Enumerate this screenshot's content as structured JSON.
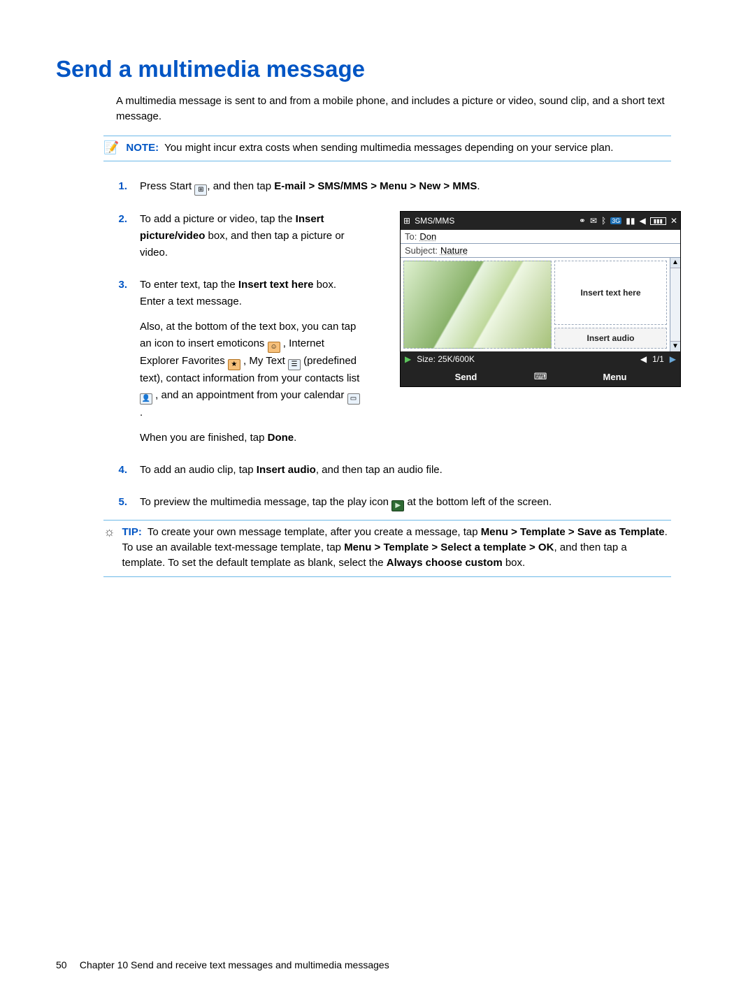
{
  "title": "Send a multimedia message",
  "intro": "A multimedia message is sent to and from a mobile phone, and includes a picture or video, sound clip, and a short text message.",
  "note": {
    "label": "NOTE:",
    "text": "You might incur extra costs when sending multimedia messages depending on your service plan."
  },
  "steps": {
    "s1": {
      "num": "1.",
      "prefix": "Press Start ",
      "mid": ", and then tap ",
      "path": "E-mail > SMS/MMS > Menu > New > MMS",
      "suffix": "."
    },
    "s2": {
      "num": "2.",
      "l1a": "To add a picture or video, tap the ",
      "b1": "Insert picture/video",
      "l1b": " box, and then tap a picture or video."
    },
    "s3": {
      "num": "3.",
      "l1a": "To enter text, tap the ",
      "b1": "Insert text here",
      "l1b": " box. Enter a text message.",
      "p2a": "Also, at the bottom of the text box, you can tap an icon to insert emoticons ",
      "p2b": " , Internet Explorer Favorites ",
      "p2c": " , My Text ",
      "p2d": " (predefined text), contact information from your contacts list ",
      "p2e": " , and an appointment from your calendar ",
      "p2f": " .",
      "p3a": "When you are finished, tap ",
      "b3": "Done",
      "p3b": "."
    },
    "s4": {
      "num": "4.",
      "a": "To add an audio clip, tap ",
      "b": "Insert audio",
      "c": ", and then tap an audio file."
    },
    "s5": {
      "num": "5.",
      "a": "To preview the multimedia message, tap the play icon ",
      "b": " at the bottom left of the screen."
    }
  },
  "tip": {
    "label": "TIP:",
    "a": "To create your own message template, after you create a message, tap ",
    "b1": "Menu > Template > Save as Template",
    "c": ". To use an available text-message template, tap ",
    "b2": "Menu > Template > Select a template > OK",
    "d": ", and then tap a template. To set the default template as blank, select the ",
    "b3": "Always choose custom",
    "e": " box."
  },
  "shot": {
    "title": "SMS/MMS",
    "to_label": "To:",
    "to_value": "Don",
    "subject_label": "Subject:",
    "subject_value": "Nature",
    "insert_text": "Insert text here",
    "insert_audio": "Insert audio",
    "size": "Size: 25K/600K",
    "pager": "1/1",
    "send": "Send",
    "menu": "Menu"
  },
  "footer": {
    "page": "50",
    "text": "Chapter 10   Send and receive text messages and multimedia messages"
  }
}
